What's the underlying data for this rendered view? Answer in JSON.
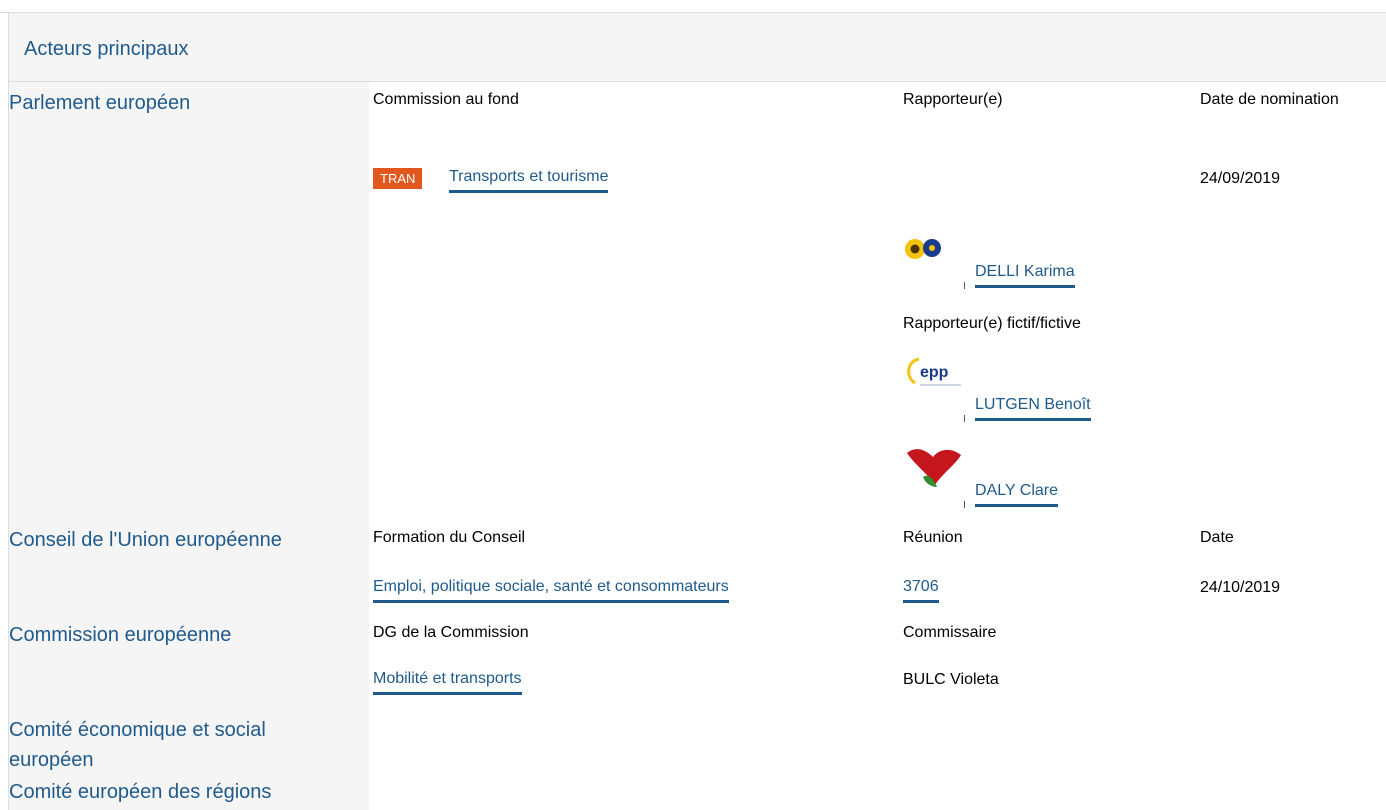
{
  "section": {
    "title": "Acteurs principaux"
  },
  "parliament": {
    "name": "Parlement européen",
    "committee_header": "Commission au fond",
    "rapporteur_header": "Rapporteur(e)",
    "date_header": "Date de nomination",
    "committee_code": "TRAN",
    "committee_name": "Transports et tourisme",
    "date": "24/09/2019",
    "rapporteur": "DELLI Karima",
    "shadow_header": "Rapporteur(e) fictif/fictive",
    "shadow1": "LUTGEN Benoît",
    "shadow2": "DALY Clare",
    "epp_logo_text": "epp",
    "colors": {
      "badge": "#e2571e",
      "link": "#1f5a8c"
    }
  },
  "council": {
    "name": "Conseil de l'Union européenne",
    "formation_header": "Formation du Conseil",
    "meeting_header": "Réunion",
    "date_header": "Date",
    "formation": "Emploi, politique sociale, santé et consommateurs",
    "meeting": "3706",
    "date": "24/10/2019"
  },
  "commission": {
    "name": "Commission européenne",
    "dg_header": "DG de la Commission",
    "commissioner_header": "Commissaire",
    "dg": "Mobilité et transports",
    "commissioner": "BULC Violeta"
  },
  "eesc": {
    "name": "Comité économique et social européen"
  },
  "cor": {
    "name": "Comité européen des régions"
  }
}
